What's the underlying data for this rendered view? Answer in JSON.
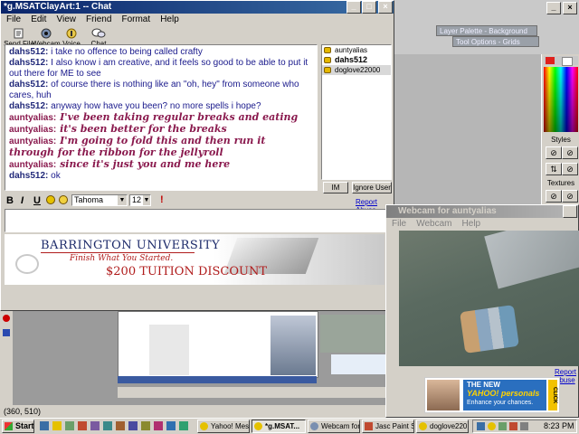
{
  "paint": {
    "layer_palette": "Layer Palette - Background",
    "tool_options": "Tool Options - Grids",
    "styles_label": "Styles",
    "textures_label": "Textures",
    "coords": "(360, 510)"
  },
  "chat": {
    "title": "*g.MSATClayArt:1 -- Chat",
    "menu": [
      "File",
      "Edit",
      "View",
      "Friend",
      "Format",
      "Help"
    ],
    "toolbar": [
      "Send File",
      "Webcam",
      "Voice",
      "Chat"
    ],
    "messages": [
      {
        "nick": "dahs512:",
        "text": " i take no offence to being called crafty",
        "styled": false
      },
      {
        "nick": "dahs512:",
        "text": " I also know i am creative, and it feels so good to be able to put it out there for ME to see",
        "styled": false
      },
      {
        "nick": "dahs512:",
        "text": " of course there is nothing like an \"oh, hey\" from someone who cares, huh",
        "styled": false
      },
      {
        "nick": "dahs512:",
        "text": " anyway how have you been? no more spells i hope?",
        "styled": false
      },
      {
        "nick": "auntyalias:",
        "text": " I've been taking regular breaks and eating",
        "styled": true
      },
      {
        "nick": "auntyalias:",
        "text": " it's been better for the breaks",
        "styled": true
      },
      {
        "nick": "auntyalias:",
        "text": " I'm going to fold this and then run it through for the ribbon for the jellyroll",
        "styled": true
      },
      {
        "nick": "auntyalias:",
        "text": " since it's just you and me here",
        "styled": true
      },
      {
        "nick": "dahs512:",
        "text": " ok",
        "styled": false
      }
    ],
    "buddies": [
      "auntyalias",
      "dahs512",
      "doglove22000"
    ],
    "im_button": "IM",
    "ignore_button": "Ignore User",
    "format_buttons": [
      "B",
      "I",
      "U"
    ],
    "font_name": "Tahoma",
    "font_size": "12",
    "report_abuse": "Report Abuse"
  },
  "ad": {
    "university": "BARRINGTON UNIVERSITY",
    "tagline": "Finish What You Started.",
    "offer": "$200 TUITION DISCOUNT"
  },
  "webcam": {
    "title": "Webcam for auntyalias",
    "menu": [
      "File",
      "Webcam",
      "Help"
    ],
    "report_abuse": "Report Abuse",
    "ad_line1": "THE NEW",
    "ad_brand": "YAHOO! personals",
    "ad_line2": "Enhance your chances.",
    "ad_click": "CLICK"
  },
  "taskbar": {
    "start": "Start",
    "tasks": [
      "Yahoo! Mes...",
      "*g.MSAT...",
      "Webcam for...",
      "Jasc Paint S...",
      "doglove220..."
    ],
    "clock": "8:23 PM"
  },
  "colors": {
    "title_active": "#0a246a",
    "nick_dahs": "#222a7a",
    "nick_aunty": "#8a1a4e",
    "ad_red": "#b01c1c",
    "ad_navy": "#1c2a6a"
  }
}
